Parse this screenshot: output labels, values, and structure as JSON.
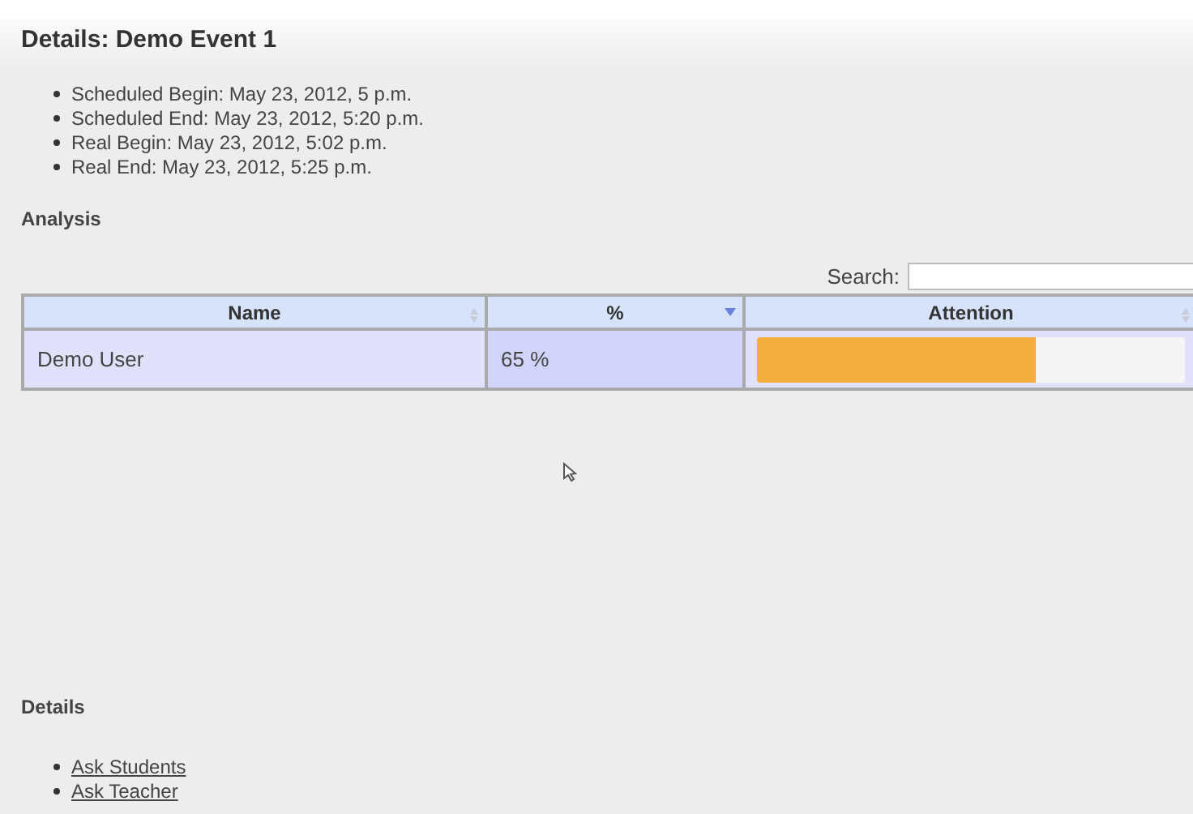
{
  "title": "Details: Demo Event 1",
  "facts": [
    "Scheduled Begin: May 23, 2012, 5 p.m.",
    "Scheduled End: May 23, 2012, 5:20 p.m.",
    "Real Begin: May 23, 2012, 5:02 p.m.",
    "Real End: May 23, 2012, 5:25 p.m."
  ],
  "analysis_heading": "Analysis",
  "search": {
    "label": "Search:"
  },
  "table": {
    "columns": [
      {
        "label": "Name",
        "sorted": false
      },
      {
        "label": "%",
        "sorted": true
      },
      {
        "label": "Attention",
        "sorted": false
      }
    ],
    "rows": [
      {
        "name": "Demo User",
        "percent": "65 %",
        "level": 0.65
      }
    ]
  },
  "details_heading": "Details",
  "links": [
    "Ask Students",
    "Ask Teacher"
  ]
}
